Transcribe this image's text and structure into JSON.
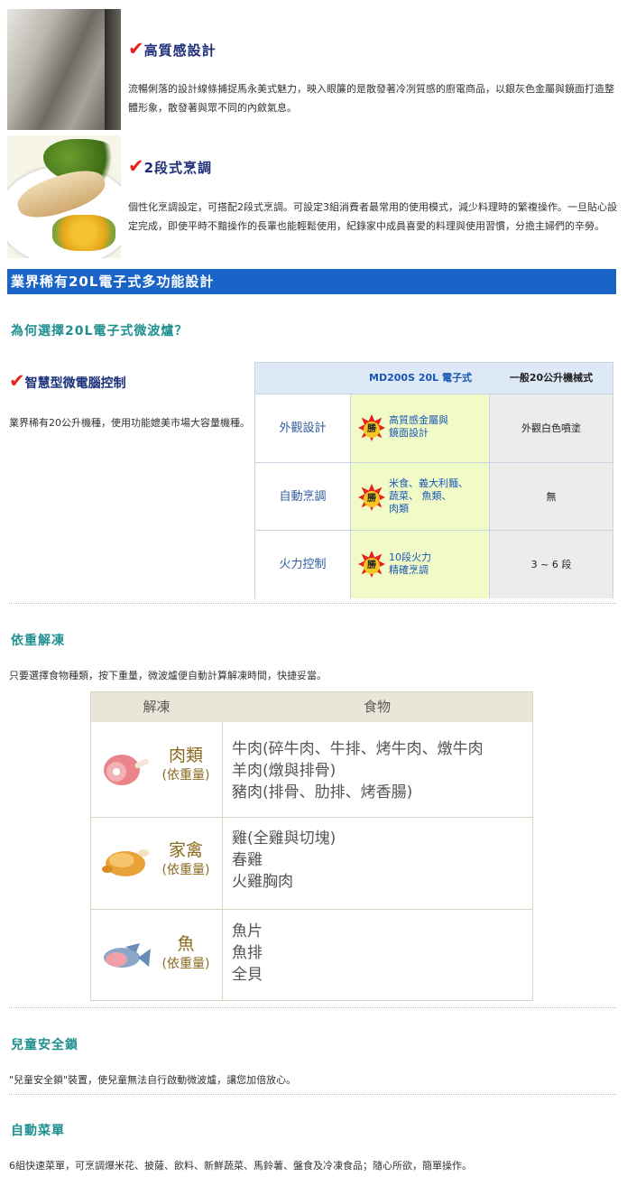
{
  "feature1": {
    "title": "高質感設計",
    "desc": "流暢俐落的設計線條捕捉馬永美式魅力，映入眼簾的是散發著冷冽質感的廚電商品，以銀灰色金屬與鏡面打造整體形象，散發著與眾不同的內斂氣息。"
  },
  "feature2": {
    "title": "2段式烹調",
    "desc": "個性化烹調設定，可搭配2段式烹調。可設定3組消費者最常用的使用模式，減少料理時的繁複操作。一旦貼心設定完成，即使平時不黯操作的長輩也能輕鬆使用，紀錄家中成員喜愛的料理與使用習慣，分擔主婦們的辛勞。"
  },
  "banner": "業界稀有20L電子式多功能設計",
  "why_heading": "為何選擇20L電子式微波爐？",
  "smart": {
    "title": "智慧型微電腦控制",
    "desc": "業界稀有20公升機種，使用功能媲美市場大容量機種。"
  },
  "compare": {
    "col1": "MD200S  20L 電子式",
    "col2": "一般20公升機械式",
    "badge": "勝",
    "rows": [
      {
        "label": "外觀設計",
        "win": [
          "高質感金屬與",
          "鏡面設計"
        ],
        "other": "外觀白色噴塗"
      },
      {
        "label": "自動烹調",
        "win": [
          "米食、義大利麵、",
          "蔬菜、 魚類、",
          "肉類"
        ],
        "other": "無"
      },
      {
        "label": "火力控制",
        "win": [
          "10段火力",
          "精確烹調"
        ],
        "other": "3 ~ 6 段"
      }
    ]
  },
  "defrost": {
    "heading": "依重解凍",
    "desc": "只要選擇食物種類，按下重量，微波爐便自動計算解凍時間，快捷妥當。",
    "col_left": "解凍",
    "col_right": "食物",
    "rows": [
      {
        "name": "肉類",
        "weight": "(依重量)",
        "foods": [
          "牛肉(碎牛肉、牛排、烤牛肉、燉牛肉",
          "羊肉(燉與排骨)",
          "豬肉(排骨、肋排、烤香腸)"
        ]
      },
      {
        "name": "家禽",
        "weight": "(依重量)",
        "foods": [
          "雞(全雞與切塊)",
          "春雞",
          "火雞胸肉"
        ]
      },
      {
        "name": "魚",
        "weight": "(依重量)",
        "foods": [
          "魚片",
          "魚排",
          "全貝"
        ]
      }
    ]
  },
  "childlock": {
    "heading": "兒童安全鎖",
    "desc": "\"兒童安全鎖\"裝置，使兒童無法自行啟動微波爐，讓您加倍放心。"
  },
  "automenu": {
    "heading": "自動菜單",
    "desc": "6組快速菜單，可烹調爆米花、披薩、飲料、新鮮蔬菜、馬鈴薯、盤食及冷凍食品；隨心所欲，簡單操作。"
  },
  "colors": {
    "banner": "#1a64c8",
    "teal": "#1f9090",
    "navy": "#1a2f7a",
    "check": "#e8211b",
    "win_bg": "#f0fbc8"
  },
  "icons": [
    "checkmark-icon",
    "win-badge-icon",
    "ham-icon",
    "roast-chicken-icon",
    "fish-icon"
  ]
}
